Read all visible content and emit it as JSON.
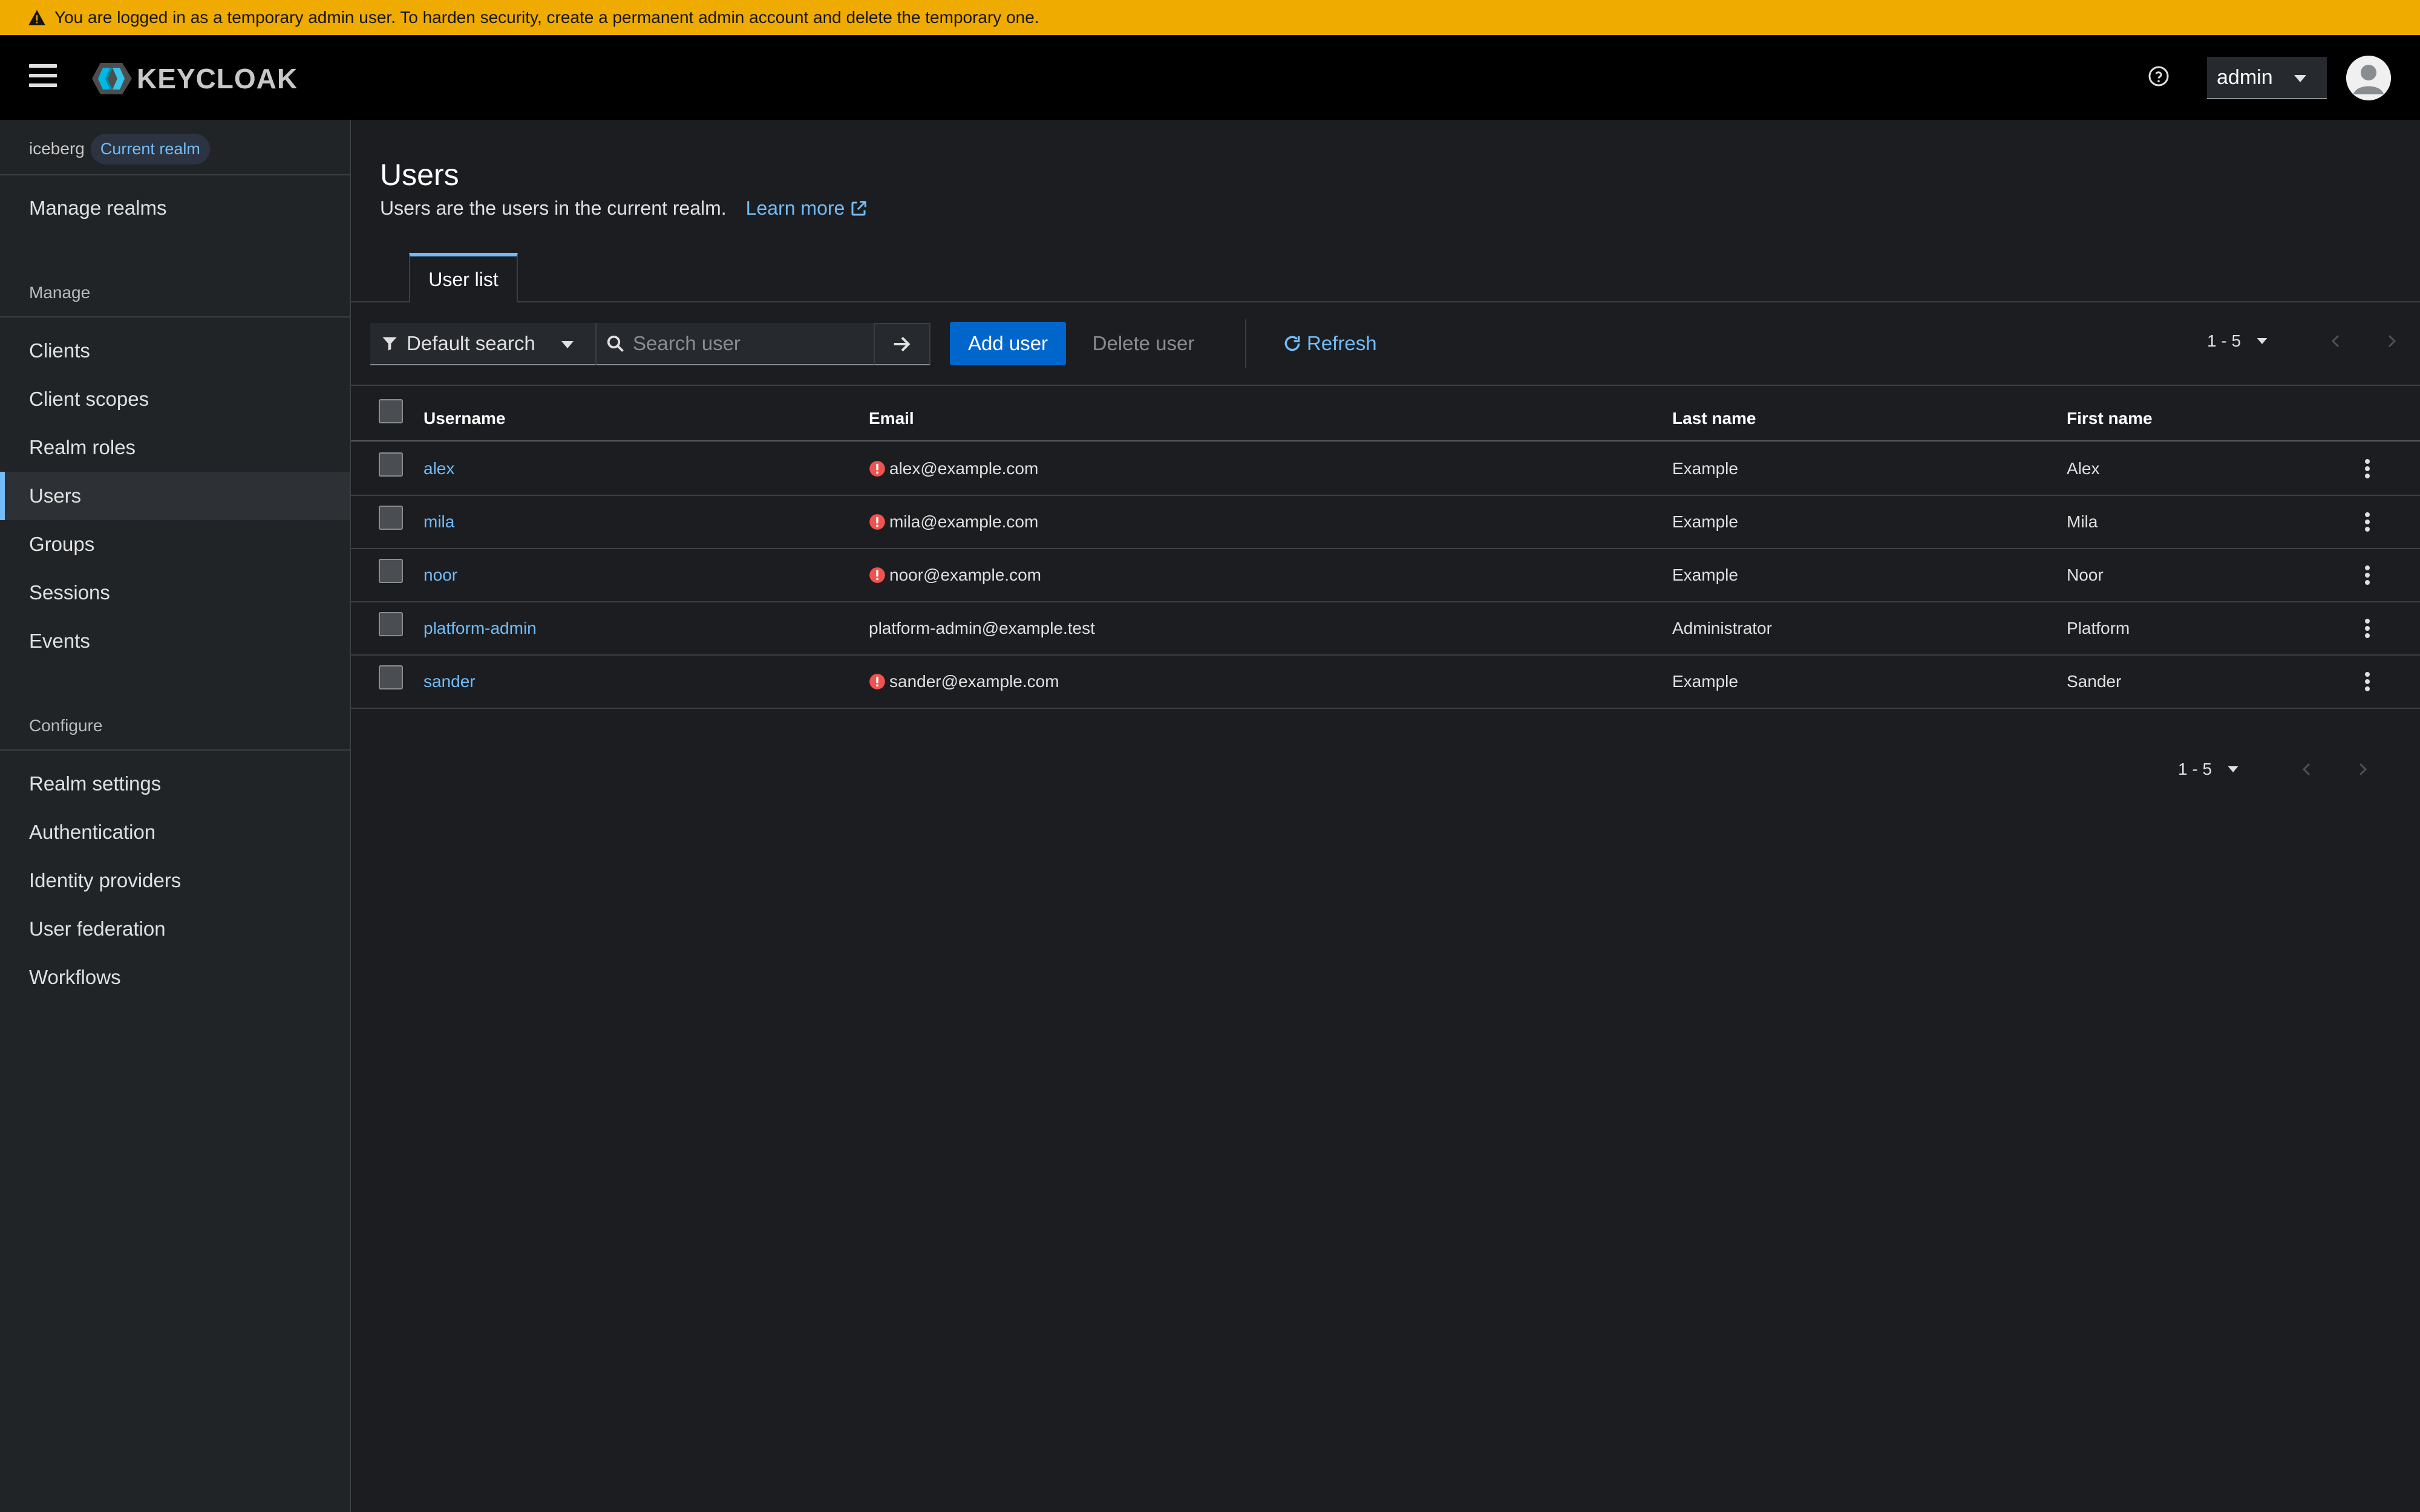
{
  "banner": {
    "text": "You are logged in as a temporary admin user. To harden security, create a permanent admin account and delete the temporary one."
  },
  "header": {
    "logo_text": "KEYCLOAK",
    "user_menu": "admin"
  },
  "sidebar": {
    "realm_name": "iceberg",
    "realm_badge": "Current realm",
    "manage_realms": "Manage realms",
    "manage_section": "Manage",
    "manage_items": [
      "Clients",
      "Client scopes",
      "Realm roles",
      "Users",
      "Groups",
      "Sessions",
      "Events"
    ],
    "configure_section": "Configure",
    "configure_items": [
      "Realm settings",
      "Authentication",
      "Identity providers",
      "User federation",
      "Workflows"
    ],
    "active": "Users"
  },
  "main": {
    "title": "Users",
    "description": "Users are the users in the current realm.",
    "learn_more": "Learn more",
    "tab": "User list"
  },
  "toolbar": {
    "filter": "Default search",
    "search_placeholder": "Search user",
    "add_user": "Add user",
    "delete_user": "Delete user",
    "refresh": "Refresh",
    "pagination": "1 - 5"
  },
  "table": {
    "columns": [
      "Username",
      "Email",
      "Last name",
      "First name"
    ],
    "rows": [
      {
        "username": "alex",
        "email": "alex@example.com",
        "email_unverified": true,
        "last_name": "Example",
        "first_name": "Alex"
      },
      {
        "username": "mila",
        "email": "mila@example.com",
        "email_unverified": true,
        "last_name": "Example",
        "first_name": "Mila"
      },
      {
        "username": "noor",
        "email": "noor@example.com",
        "email_unverified": true,
        "last_name": "Example",
        "first_name": "Noor"
      },
      {
        "username": "platform-admin",
        "email": "platform-admin@example.test",
        "email_unverified": false,
        "last_name": "Administrator",
        "first_name": "Platform"
      },
      {
        "username": "sander",
        "email": "sander@example.com",
        "email_unverified": true,
        "last_name": "Example",
        "first_name": "Sander"
      }
    ]
  },
  "bottom_pagination": "1 - 5",
  "colors": {
    "banner": "#f0ab00",
    "link": "#73bcf7",
    "primary": "#0066cc",
    "error": "#f0524f",
    "background": "#1b1d21",
    "sidebar": "#212427"
  }
}
